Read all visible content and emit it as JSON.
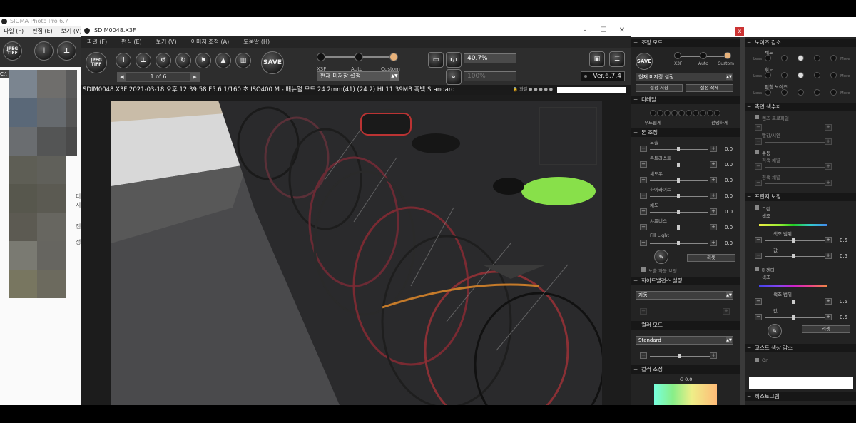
{
  "main_window": {
    "title": "SIGMA Photo Pro 6.7",
    "menu": [
      "파일 (F)",
      "편집 (E)",
      "보기 (V)"
    ],
    "tree_label": "C:\\",
    "side_chars": [
      "디",
      "지",
      "전",
      "정"
    ]
  },
  "preview_window": {
    "title": "SDIM0048.X3F",
    "menu": [
      "파일 (F)",
      "편집 (E)",
      "보기 (V)",
      "이미지 조정 (A)",
      "도움말 (H)"
    ],
    "toolbar": {
      "jpeg_tiff_label": "JPEG TIFF",
      "save_label": "SAVE",
      "mode_labels": [
        "X3F",
        "Auto",
        "Custom"
      ],
      "preset_value": "현재 미저장 설정",
      "zoom_value": "40.7%",
      "zoom2_value": "100%",
      "page_counter": "1 of 6",
      "version": "Ver.6.7.4"
    },
    "info_line": "SDIM0048.X3F 2021-03-18 오후 12:39:58 F5.6 1/160 초 ISO400 M - 매뉴얼 모드 24.2mm(41) (24.2) HI 11.39MB 흑백 Standard",
    "info_mini": "🔒 화밸 ● ● ● ● ●"
  },
  "panel1": {
    "sec_adjust_mode": "조정 모드",
    "save_label": "SAVE",
    "mode_labels": [
      "X3F",
      "Auto",
      "Custom"
    ],
    "preset_value": "현재 미저장 설정",
    "save_setting": "설정 저장",
    "delete_setting": "설정 삭제",
    "sec_detail": "디테일",
    "detail_left": "부드럽게",
    "detail_right": "선명하게",
    "sec_color_adjust": "톤 조정",
    "sliders": [
      {
        "label": "노출",
        "value": "0.0"
      },
      {
        "label": "콘트라스트",
        "value": "0.0"
      },
      {
        "label": "섀도우",
        "value": "0.0"
      },
      {
        "label": "하이라이트",
        "value": "0.0"
      },
      {
        "label": "채도",
        "value": "0.0"
      },
      {
        "label": "샤프니스",
        "value": "0.0"
      },
      {
        "label": "Fill Light",
        "value": "0.0"
      }
    ],
    "reset_label": "리셋",
    "auto_check": "노출 자동 보정",
    "sec_wb": "화이트밸런스 설정",
    "wb_value": "자동",
    "sec_color_mode": "컬러 모드",
    "color_mode_value": "Standard",
    "sec_color_tone": "컬러 조정",
    "color_tone_label": "G 0.0"
  },
  "panel2": {
    "sec_noise": "노이즈 감소",
    "noise_rows": [
      {
        "label": "채도",
        "left": "Less",
        "right": "More"
      },
      {
        "label": "휘도",
        "left": "Less",
        "right": "More"
      },
      {
        "label": "펀칭 노이즈",
        "left": "Less",
        "right": "More"
      }
    ],
    "sec_lens": "측면 색수차",
    "lens_check": "렌즈 프로파일",
    "lens_row1": "빨강/시안",
    "lens_manual": "수동",
    "lens_row2": "적색 채널",
    "lens_row3": "청색 채널",
    "sec_fringe": "프린지 보정",
    "fringe_green": "그린",
    "fringe_color_label": "색조",
    "fringe_range": "색조 범위",
    "fringe_amount": "값",
    "fringe_val": "0.5",
    "fringe_magenta": "마젠타",
    "reset_label": "리셋",
    "sec_ghost": "고스트 색상 감소",
    "ghost_check": "On",
    "sec_histogram": "히스토그램"
  },
  "colors": {
    "accent_orange": "#e8b27a",
    "close_red": "#cc3333",
    "green_gradient_center": "#22cc22",
    "magenta_gradient_center": "#cc22cc"
  }
}
